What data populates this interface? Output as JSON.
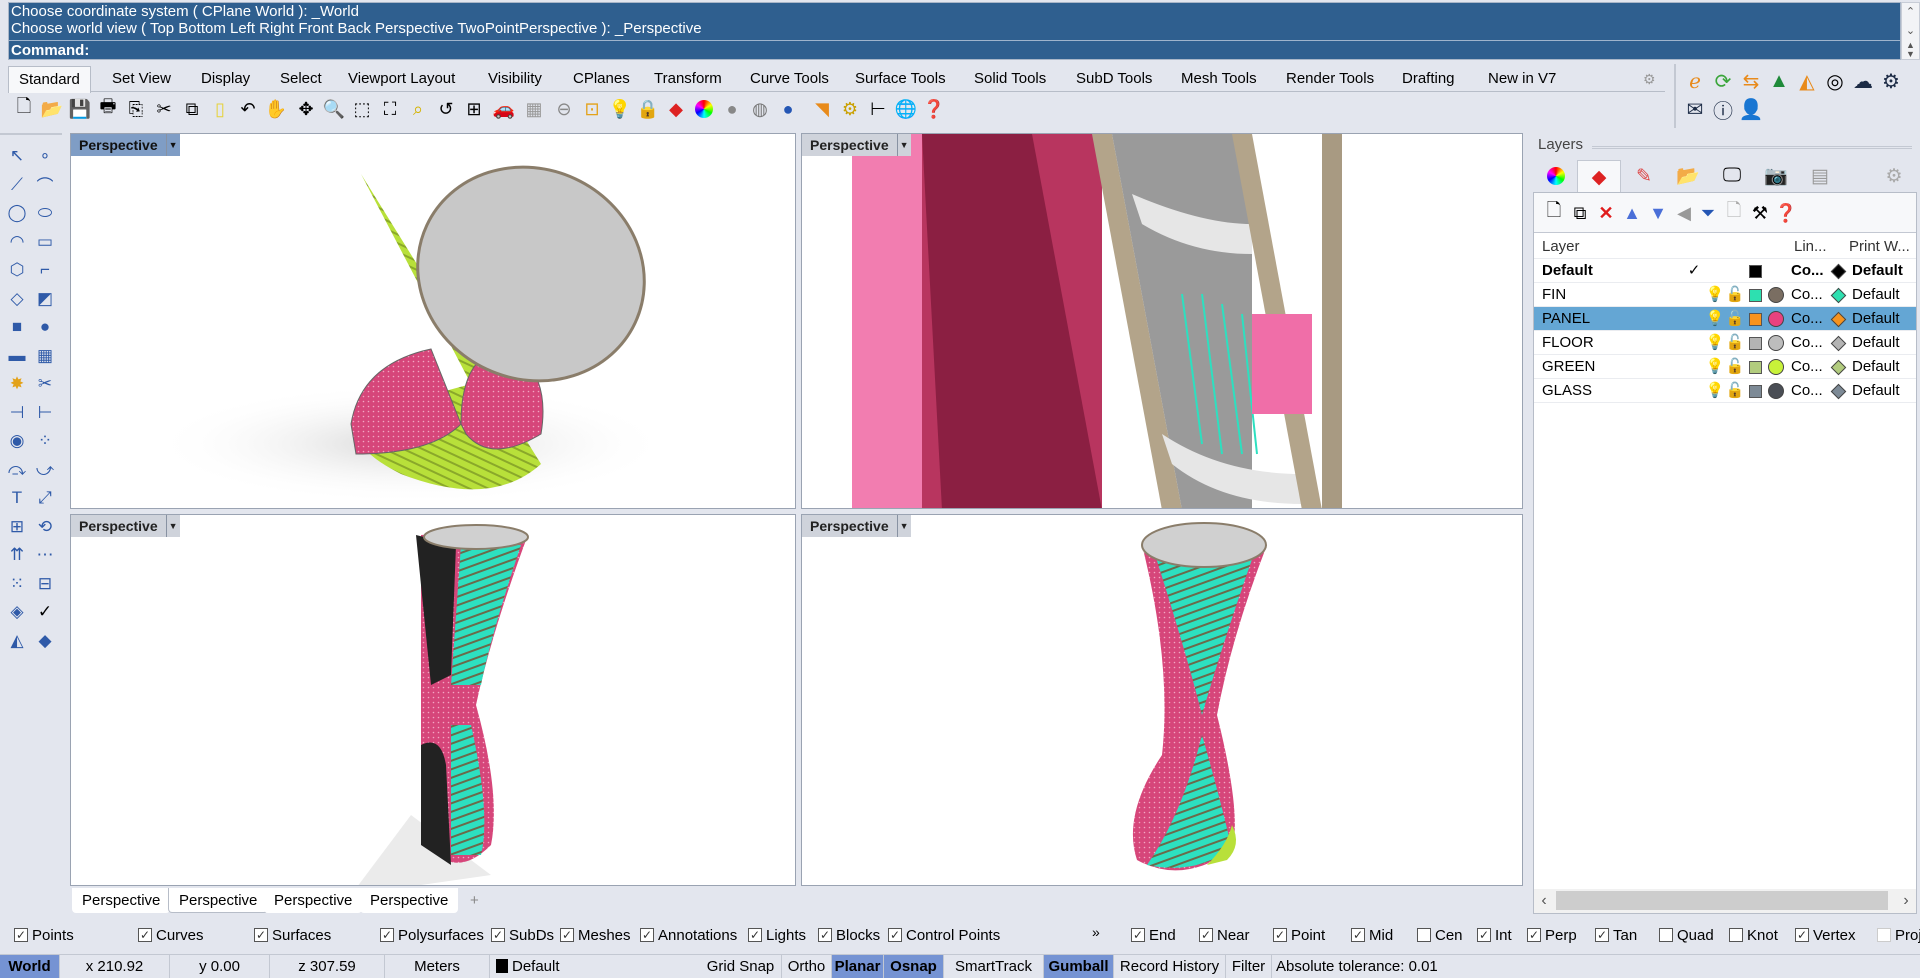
{
  "command": {
    "history": [
      "Choose coordinate system ( CPlane  World ): _World",
      "Choose world view ( Top  Bottom  Left  Right  Front  Back  Perspective  TwoPointPerspective ): _Perspective"
    ],
    "prompt": "Command:",
    "prompt_value": ""
  },
  "toolbar_tabs": [
    "Standard",
    "Set View",
    "Display",
    "Select",
    "Viewport Layout",
    "Visibility",
    "CPlanes",
    "Transform",
    "Curve Tools",
    "Surface Tools",
    "Solid Tools",
    "SubD Tools",
    "Mesh Tools",
    "Render Tools",
    "Drafting",
    "New in V7"
  ],
  "active_tab": "Standard",
  "standard_tools": [
    "new",
    "open",
    "save",
    "print",
    "import",
    "cut",
    "copy",
    "paste",
    "undo",
    "pan",
    "rotate-view",
    "zoom",
    "zoom-window",
    "zoom-extents",
    "zoom-selected",
    "undo-view",
    "four-viewports",
    "car",
    "grid",
    "osnap",
    "gumball",
    "light",
    "lock",
    "layer",
    "color-wheel",
    "shaded",
    "rendered",
    "material",
    "spotlight",
    "options",
    "dimension",
    "globe",
    "help"
  ],
  "right_tools": [
    "rhino-plugin",
    "refresh",
    "sync",
    "tree",
    "palette",
    "checker",
    "cloud-upload",
    "settings-gear",
    "mail",
    "info",
    "user"
  ],
  "left_tools": [
    "select",
    "point",
    "polyline",
    "curve",
    "circle",
    "ellipse",
    "arc",
    "rectangle",
    "polygon",
    "fillet",
    "surface-from-points",
    "loft",
    "box",
    "sphere",
    "cylinder",
    "mesh",
    "explode",
    "trim",
    "split",
    "join",
    "boolean",
    "point-cloud",
    "offset",
    "blend",
    "text",
    "move",
    "group",
    "rotate",
    "extrude",
    "array-linear",
    "array",
    "align",
    "analyze",
    "check",
    "solid",
    "render"
  ],
  "viewports": [
    {
      "label": "Perspective",
      "active": true
    },
    {
      "label": "Perspective",
      "active": false
    },
    {
      "label": "Perspective",
      "active": false
    },
    {
      "label": "Perspective",
      "active": false
    }
  ],
  "viewport_tabs": [
    "Perspective",
    "Perspective",
    "Perspective",
    "Perspective"
  ],
  "add_viewport_tab": "+",
  "layers": {
    "title": "Layers",
    "panel_tabs": [
      "properties-color",
      "layers",
      "render-brush",
      "libraries",
      "display",
      "named-views",
      "layouts"
    ],
    "toolbar": [
      "new-layer",
      "new-sublayer",
      "delete",
      "move-up",
      "move-down",
      "move-to-parent",
      "filter",
      "copy",
      "tools",
      "help"
    ],
    "columns": [
      "Layer",
      "",
      "",
      "",
      "",
      "Lin...",
      "",
      "Print W..."
    ],
    "rows": [
      {
        "name": "Default",
        "current": true,
        "bold": true,
        "color": "#000000",
        "material_color": "",
        "linetype": "Co...",
        "print_color": "#000000",
        "print_width": "Default"
      },
      {
        "name": "FIN",
        "current": false,
        "bold": false,
        "color": "#2de0b0",
        "material_color": "#7a6e62",
        "linetype": "Co...",
        "print_color": "#2de0b0",
        "print_width": "Default"
      },
      {
        "name": "PANEL",
        "current": false,
        "bold": false,
        "selected": true,
        "color": "#f7931e",
        "material_color": "#e8427f",
        "linetype": "Co...",
        "print_color": "#f7931e",
        "print_width": "Default"
      },
      {
        "name": "FLOOR",
        "current": false,
        "bold": false,
        "color": "#b4b4b4",
        "material_color": "#bdbdbd",
        "linetype": "Co...",
        "print_color": "#b4b4b4",
        "print_width": "Default"
      },
      {
        "name": "GREEN",
        "current": false,
        "bold": false,
        "color": "#b2cc7e",
        "material_color": "#c8f23a",
        "linetype": "Co...",
        "print_color": "#b2cc7e",
        "print_width": "Default"
      },
      {
        "name": "GLASS",
        "current": false,
        "bold": false,
        "color": "#7d8a96",
        "material_color": "#4a4e55",
        "linetype": "Co...",
        "print_color": "#7d8a96",
        "print_width": "Default"
      }
    ]
  },
  "object_filters": [
    {
      "label": "Points",
      "checked": true
    },
    {
      "label": "Curves",
      "checked": true
    },
    {
      "label": "Surfaces",
      "checked": true
    },
    {
      "label": "Polysurfaces",
      "checked": true
    },
    {
      "label": "SubDs",
      "checked": true
    },
    {
      "label": "Meshes",
      "checked": true
    },
    {
      "label": "Annotations",
      "checked": true
    },
    {
      "label": "Lights",
      "checked": true
    },
    {
      "label": "Blocks",
      "checked": true
    },
    {
      "label": "Control Points",
      "checked": true
    }
  ],
  "more_label": "»",
  "osnaps": [
    {
      "label": "End",
      "checked": true
    },
    {
      "label": "Near",
      "checked": true
    },
    {
      "label": "Point",
      "checked": true
    },
    {
      "label": "Mid",
      "checked": true
    },
    {
      "label": "Cen",
      "checked": false
    },
    {
      "label": "Int",
      "checked": true
    },
    {
      "label": "Perp",
      "checked": true
    },
    {
      "label": "Tan",
      "checked": true
    },
    {
      "label": "Quad",
      "checked": false
    },
    {
      "label": "Knot",
      "checked": false
    },
    {
      "label": "Vertex",
      "checked": true
    },
    {
      "label": "Project",
      "checked": false,
      "disabled": true
    }
  ],
  "status": {
    "cplane": "World",
    "x": "x 210.92",
    "y": "y 0.00",
    "z": "z 307.59",
    "units": "Meters",
    "layer": "Default",
    "toggles": [
      {
        "label": "Grid Snap",
        "on": false
      },
      {
        "label": "Ortho",
        "on": false
      },
      {
        "label": "Planar",
        "on": true
      },
      {
        "label": "Osnap",
        "on": true
      },
      {
        "label": "SmartTrack",
        "on": false
      },
      {
        "label": "Gumball",
        "on": true
      },
      {
        "label": "Record History",
        "on": false
      },
      {
        "label": "Filter",
        "on": false
      }
    ],
    "tolerance": "Absolute tolerance: 0.01"
  },
  "colors": {
    "command_bg": "#2f5f8f",
    "active_viewport_label": "#7f9dc5",
    "selected_row": "#64a6d4",
    "status_on": "#7593d3",
    "panel_pink": "#d6467a",
    "fin_cyan": "#2de0b0",
    "green_lime": "#b8e03a"
  }
}
